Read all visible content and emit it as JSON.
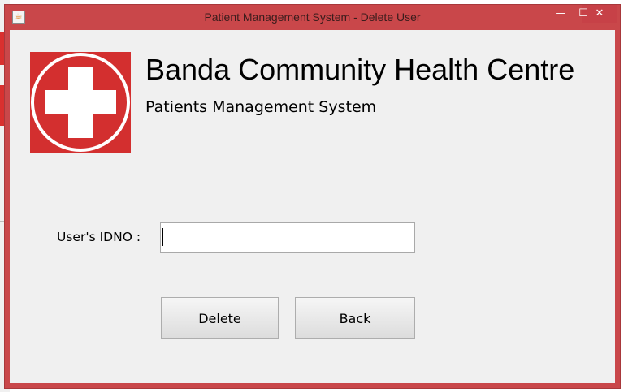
{
  "window": {
    "title": "Patient Management System - Delete User",
    "controls": {
      "minimize": "—",
      "maximize": "☐",
      "close": "✕"
    }
  },
  "header": {
    "organization": "Banda Community Health Centre",
    "system_name": "Patients Management System",
    "logo_icon": "red-cross-logo-icon"
  },
  "form": {
    "id_label": "User's IDNO :",
    "id_value": "",
    "id_placeholder": ""
  },
  "actions": {
    "delete_label": "Delete",
    "back_label": "Back"
  },
  "colors": {
    "title_bar": "#c9474a",
    "logo_red": "#d32f2f",
    "content_bg": "#f0f0f0"
  }
}
